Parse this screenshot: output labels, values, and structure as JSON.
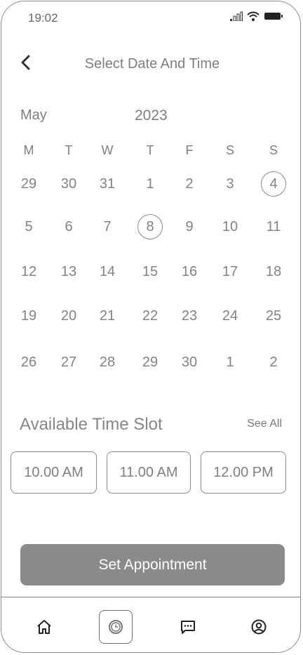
{
  "status_bar": {
    "time": "19:02"
  },
  "header": {
    "title": "Select Date And Time"
  },
  "calendar": {
    "month": "May",
    "year": "2023",
    "weekdays": [
      "M",
      "T",
      "W",
      "T",
      "F",
      "S",
      "S"
    ],
    "weeks": [
      [
        "29",
        "30",
        "31",
        "1",
        "2",
        "3",
        "4"
      ],
      [
        "5",
        "6",
        "7",
        "8",
        "9",
        "10",
        "11"
      ],
      [
        "12",
        "13",
        "14",
        "15",
        "16",
        "17",
        "18"
      ],
      [
        "19",
        "20",
        "21",
        "22",
        "23",
        "24",
        "25"
      ],
      [
        "26",
        "27",
        "28",
        "29",
        "30",
        "1",
        "2"
      ]
    ],
    "circled_days": [
      "4",
      "8"
    ]
  },
  "time_slots": {
    "heading": "Available Time Slot",
    "see_all": "See All",
    "slots": [
      "10.00 AM",
      "11.00 AM",
      "12.00 PM"
    ]
  },
  "cta": {
    "label": "Set Appointment"
  },
  "nav": {
    "items": [
      "home-icon",
      "clock-icon",
      "chat-icon",
      "profile-icon"
    ],
    "active": "clock-icon"
  },
  "colors": {
    "accent": "#8a8a8a",
    "text": "#7e7e7e",
    "background": "#ffffff"
  }
}
